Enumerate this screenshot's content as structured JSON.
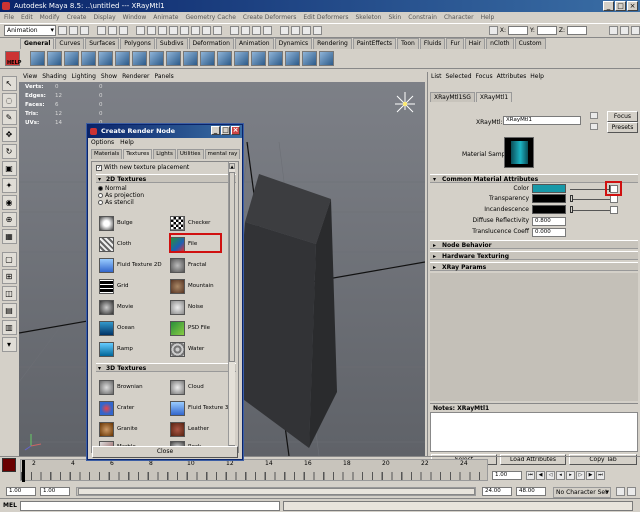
{
  "app": {
    "title": "Autodesk Maya 8.5: ..\\untitled    ---    XRayMtl1",
    "menus": [
      "File",
      "Edit",
      "Modify",
      "Create",
      "Display",
      "Window",
      "Animate",
      "Geometry Cache",
      "Create Deformers",
      "Edit Deformers",
      "Skeleton",
      "Skin",
      "Constrain",
      "Character",
      "Help"
    ],
    "mode": "Animation",
    "status_labels": {
      "x": "X:",
      "y": "Y:",
      "z": "Z:"
    },
    "shelf_tabs": [
      "General",
      "Curves",
      "Surfaces",
      "Polygons",
      "Subdivs",
      "Deformation",
      "Animation",
      "Dynamics",
      "Rendering",
      "PaintEffects",
      "Toon",
      "Fluids",
      "Fur",
      "Hair",
      "nCloth",
      "Custom"
    ],
    "shelf_help": "HELP"
  },
  "panel": {
    "menus": [
      "View",
      "Shading",
      "Lighting",
      "Show",
      "Renderer",
      "Panels"
    ],
    "hud": [
      {
        "label": "Verts:",
        "a": "0",
        "b": "0"
      },
      {
        "label": "Edges:",
        "a": "12",
        "b": "0"
      },
      {
        "label": "Faces:",
        "a": "6",
        "b": "0"
      },
      {
        "label": "Tris:",
        "a": "12",
        "b": "0"
      },
      {
        "label": "UVs:",
        "a": "14",
        "b": "0"
      }
    ]
  },
  "attr_editor": {
    "menus": [
      "List",
      "Selected",
      "Focus",
      "Attributes",
      "Help"
    ],
    "tabs": [
      "XRayMtl1SG",
      "XRayMtl1"
    ],
    "node_label": "XRayMtl:",
    "node_name": "XRayMtl1",
    "focus_btn": "Focus",
    "presets_btn": "Presets",
    "material_sample": "Material Sample",
    "sections": {
      "common": "Common Material Attributes",
      "node_behavior": "Node Behavior",
      "hardware": "Hardware Texturing",
      "xray": "XRay Params"
    },
    "attrs": {
      "color": "Color",
      "transparency": "Transparency",
      "incandescence": "Incandescence",
      "diffuse": "Diffuse Reflectivity",
      "diffuse_val": "0.800",
      "translucence": "Translucence Coeff",
      "translucence_val": "0.000"
    },
    "notes_label": "Notes:  XRayMtl1",
    "buttons": {
      "select": "Select",
      "load": "Load Attributes",
      "copy": "Copy Tab"
    },
    "colors": {
      "color_swatch": "#1899a8",
      "dark_swatch": "#000000"
    }
  },
  "dialog": {
    "title": "Create Render Node",
    "menus": [
      "Options",
      "Help"
    ],
    "tabs": [
      "Materials",
      "Textures",
      "Lights",
      "Utilities",
      "mental ray"
    ],
    "checkbox": "With new texture placement",
    "section_2d": "2D Textures",
    "radios": [
      "Normal",
      "As projection",
      "As stencil"
    ],
    "textures_2d": [
      "Bulge",
      "Checker",
      "Cloth",
      "File",
      "Fluid Texture 2D",
      "Fractal",
      "Grid",
      "Mountain",
      "Movie",
      "Noise",
      "Ocean",
      "PSD File",
      "Ramp",
      "Water"
    ],
    "section_3d": "3D Textures",
    "textures_3d": [
      "Brownian",
      "Cloud",
      "Crater",
      "Fluid Texture 3D",
      "Granite",
      "Leather",
      "Marble",
      "Rock"
    ],
    "close": "Close"
  },
  "timeline": {
    "ticks": [
      "2",
      "4",
      "6",
      "8",
      "10",
      "12",
      "14",
      "16",
      "18",
      "20",
      "22",
      "24"
    ],
    "current": "1.00",
    "start": "1.00",
    "start2": "1.00",
    "end": "24.00",
    "end2": "48.00",
    "character": "No Character Set"
  },
  "commandline": {
    "label": "MEL"
  }
}
